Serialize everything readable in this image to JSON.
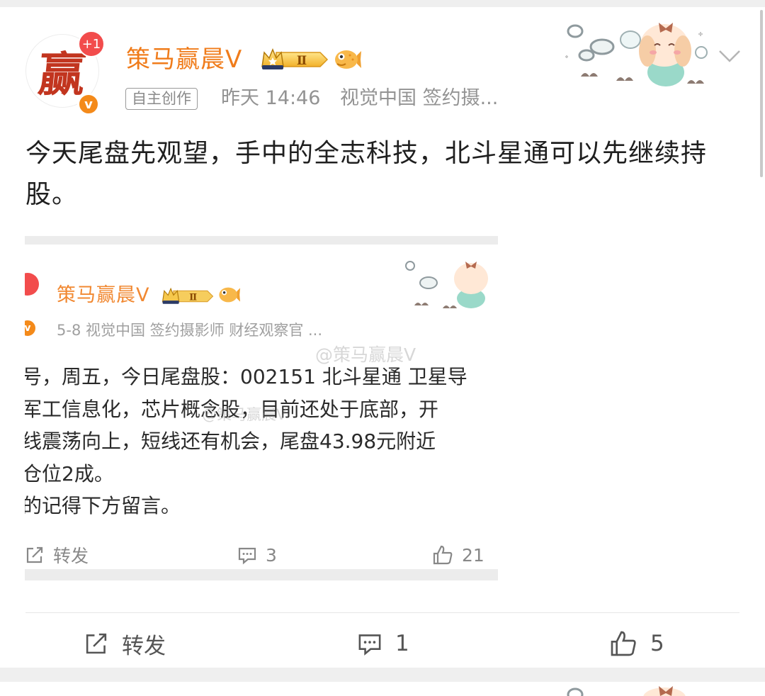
{
  "post": {
    "avatar_char": "赢",
    "plus_badge": "+1",
    "verified_mark": "v",
    "username": "策马赢晨V",
    "level_badge": "Ⅱ",
    "tag": "自主创作",
    "time": "昨天 14:46",
    "source": "视觉中国 签约摄...",
    "text": "今天尾盘先观望，手中的全志科技，北斗星通可以先继续持股。"
  },
  "embedded_post": {
    "username": "策马赢晨V",
    "level_badge": "Ⅱ",
    "meta": "5-8  视觉中国 签约摄影师 财经观察官 ...",
    "lines": [
      "号，周五，今日尾盘股：002151 北斗星通 卫星导",
      "军工信息化，芯片概念股，目前还处于底部，开",
      "线震荡向上，短线还有机会，尾盘43.98元附近",
      "仓位2成。",
      "的记得下方留言。"
    ],
    "actions": {
      "repost_label": "转发",
      "comment_count": "3",
      "like_count": "21"
    },
    "watermark_1": "@策马赢晨V",
    "watermark_2": "@策马赢晨V"
  },
  "actions": {
    "repost_label": "转发",
    "comment_count": "1",
    "like_count": "5"
  },
  "colors": {
    "username": "#f07c1b",
    "meta": "#939393",
    "body_text": "#1f1f1f",
    "badge_red": "#f24c4c",
    "verified_orange": "#f48a1a"
  },
  "icons": [
    "chevron-down-icon",
    "crown-badge-icon",
    "fish-emoji-icon",
    "repost-icon",
    "comment-icon",
    "like-icon"
  ]
}
